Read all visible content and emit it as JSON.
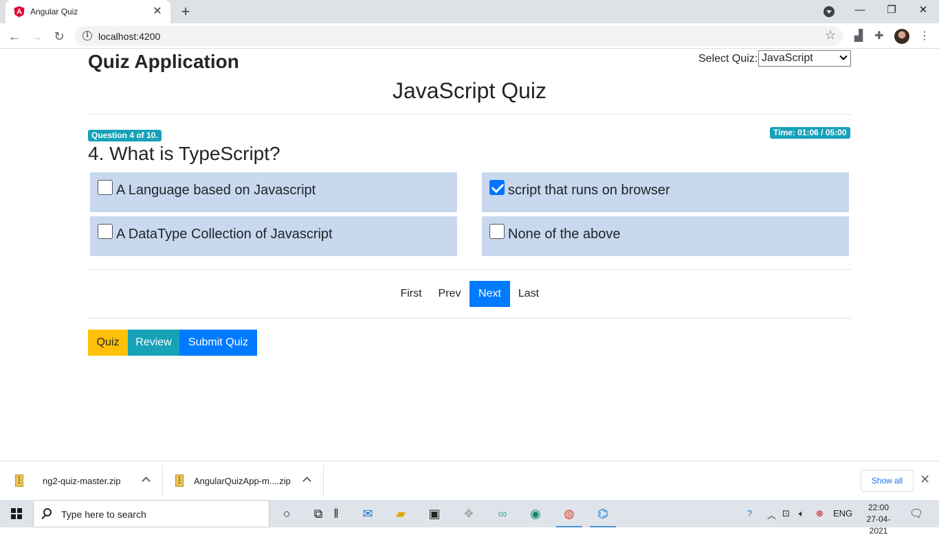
{
  "browser": {
    "tab_title": "Angular Quiz",
    "tab_close": "✕",
    "new_tab": "+",
    "url": "localhost:4200",
    "win_min": "—",
    "win_restore": "❐",
    "win_close": "✕"
  },
  "header": {
    "app_title": "Quiz Application",
    "select_label": "Select Quiz:",
    "select_value": "JavaScript",
    "quiz_name": "JavaScript Quiz"
  },
  "question": {
    "progress_badge": "Question 4 of 10.",
    "timer_badge": "Time: 01:06 / 05:00",
    "text": "4. What is TypeScript?",
    "options": [
      {
        "label": "A Language based on Javascript",
        "checked": false
      },
      {
        "label": "script that runs on browser",
        "checked": true
      },
      {
        "label": "A DataType Collection of Javascript",
        "checked": false
      },
      {
        "label": "None of the above",
        "checked": false
      }
    ]
  },
  "pager": {
    "first": "First",
    "prev": "Prev",
    "next": "Next",
    "last": "Last"
  },
  "modes": {
    "quiz": "Quiz",
    "review": "Review",
    "submit": "Submit Quiz"
  },
  "colors": {
    "quiz": "#ffc107",
    "review": "#17a2b8",
    "submit": "#007bff",
    "option_bg": "#c8d8ee"
  },
  "downloads": {
    "items": [
      {
        "name": "ng2-quiz-master.zip"
      },
      {
        "name": "AngularQuizApp-m....zip"
      }
    ],
    "show_all": "Show all",
    "close": "✕"
  },
  "taskbar": {
    "search_placeholder": "Type here to search",
    "lang": "ENG",
    "time": "22:00",
    "date": "27-04-2021"
  }
}
